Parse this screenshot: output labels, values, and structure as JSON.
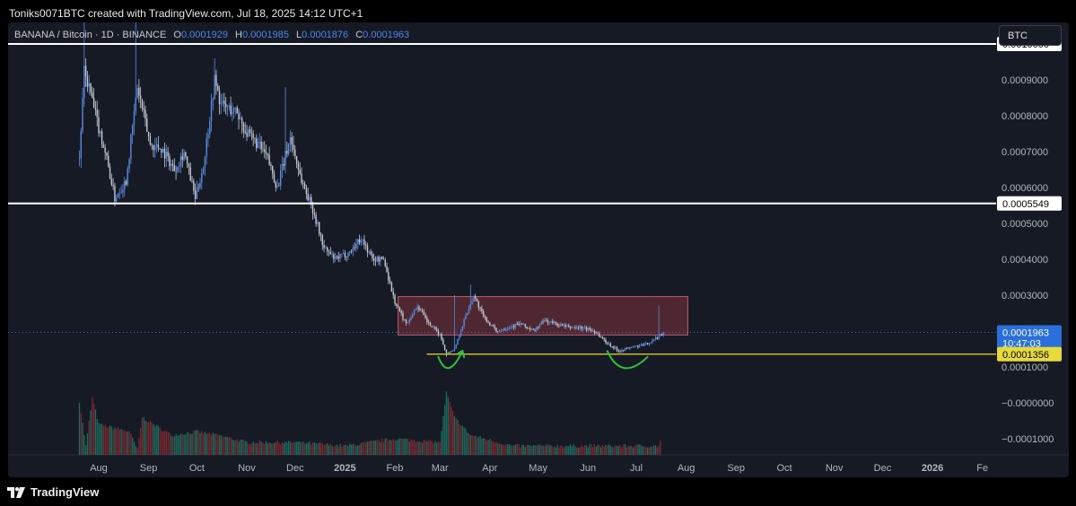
{
  "header": {
    "attribution": "Toniks0071BTC created with TradingView.com, Jul 18, 2025 14:12 UTC+1"
  },
  "footer": {
    "brand": "TradingView"
  },
  "legend": {
    "symbol": "BANANA / Bitcoin · 1D · BINANCE",
    "o_label": "O",
    "o_value": "0.0001929",
    "h_label": "H",
    "h_value": "0.0001985",
    "l_label": "L",
    "l_value": "0.0001876",
    "c_label": "C",
    "c_value": "0.0001963"
  },
  "currency_button": "BTC",
  "colors": {
    "background": "#161a25",
    "candle_up": "#5b8be0",
    "candle_down": "#c5c8d0",
    "volume_up": "#1f6b5e",
    "volume_down": "#7a2a31",
    "box_fill": "#5c2a35",
    "box_border": "#c0596b",
    "level_line": "#ffffff",
    "support_line": "#e6d93a",
    "pattern": "#35c03a",
    "price_badge": "#2a6fdb"
  },
  "chart_data": {
    "type": "candlestick",
    "scale": "linear",
    "y_tick_labels": [
      "0.0009000",
      "0.0008000",
      "0.0007000",
      "0.0006000",
      "0.0005000",
      "0.0004000",
      "0.0003000",
      "0.0001000",
      "−0.0000000",
      "−0.0001000"
    ],
    "y_tick_values": [
      0.0009,
      0.0008,
      0.0007,
      0.0006,
      0.0005,
      0.0004,
      0.0003,
      0.0001,
      0,
      -0.0001
    ],
    "ylim": [
      -0.000145,
      0.00106
    ],
    "x_tick_labels": [
      "Aug",
      "Sep",
      "Oct",
      "Nov",
      "Dec",
      "2025",
      "Feb",
      "Mar",
      "Apr",
      "May",
      "Jun",
      "Jul",
      "Aug",
      "Sep",
      "Oct",
      "Nov",
      "Dec",
      "2026",
      "Fe"
    ],
    "x_tick_dates": [
      "2024-08-01",
      "2024-09-01",
      "2024-10-01",
      "2024-11-01",
      "2024-12-01",
      "2025-01-01",
      "2025-02-01",
      "2025-03-01",
      "2025-04-01",
      "2025-05-01",
      "2025-06-01",
      "2025-07-01",
      "2025-08-01",
      "2025-09-01",
      "2025-10-01",
      "2025-11-01",
      "2025-12-01",
      "2026-01-01",
      "2026-02-01"
    ],
    "x_bold_labels": [
      "2025",
      "2026"
    ],
    "price_keypoints": [
      [
        "2024-07-20",
        0.00068
      ],
      [
        "2024-07-23",
        0.00092
      ],
      [
        "2024-07-26",
        0.00088
      ],
      [
        "2024-07-30",
        0.0008
      ],
      [
        "2024-08-05",
        0.0007
      ],
      [
        "2024-08-11",
        0.00057
      ],
      [
        "2024-08-18",
        0.00062
      ],
      [
        "2024-08-25",
        0.00088
      ],
      [
        "2024-09-02",
        0.00072
      ],
      [
        "2024-09-09",
        0.00071
      ],
      [
        "2024-09-17",
        0.00065
      ],
      [
        "2024-09-23",
        0.0007
      ],
      [
        "2024-09-30",
        0.00057
      ],
      [
        "2024-10-05",
        0.00066
      ],
      [
        "2024-10-12",
        0.0009
      ],
      [
        "2024-10-16",
        0.00083
      ],
      [
        "2024-10-26",
        0.00081
      ],
      [
        "2024-11-01",
        0.00075
      ],
      [
        "2024-11-08",
        0.00072
      ],
      [
        "2024-11-14",
        0.00068
      ],
      [
        "2024-11-20",
        0.0006
      ],
      [
        "2024-11-28",
        0.00074
      ],
      [
        "2024-12-05",
        0.00062
      ],
      [
        "2024-12-12",
        0.00054
      ],
      [
        "2024-12-19",
        0.00043
      ],
      [
        "2024-12-26",
        0.0004
      ],
      [
        "2025-01-04",
        0.00042
      ],
      [
        "2025-01-11",
        0.00046
      ],
      [
        "2025-01-18",
        0.0004
      ],
      [
        "2025-01-25",
        0.0004
      ],
      [
        "2025-02-01",
        0.00028
      ],
      [
        "2025-02-08",
        0.00022
      ],
      [
        "2025-02-15",
        0.00027
      ],
      [
        "2025-02-22",
        0.00022
      ],
      [
        "2025-03-01",
        0.00019
      ],
      [
        "2025-03-05",
        0.000138
      ],
      [
        "2025-03-10",
        0.00015
      ],
      [
        "2025-03-16",
        0.00023
      ],
      [
        "2025-03-22",
        0.0003
      ],
      [
        "2025-03-28",
        0.00024
      ],
      [
        "2025-04-05",
        0.0002
      ],
      [
        "2025-04-12",
        0.00021
      ],
      [
        "2025-04-20",
        0.00022
      ],
      [
        "2025-04-28",
        0.0002
      ],
      [
        "2025-05-05",
        0.00023
      ],
      [
        "2025-05-12",
        0.00022
      ],
      [
        "2025-05-20",
        0.00021
      ],
      [
        "2025-05-28",
        0.00021
      ],
      [
        "2025-06-05",
        0.0002
      ],
      [
        "2025-06-12",
        0.00017
      ],
      [
        "2025-06-20",
        0.000145
      ],
      [
        "2025-06-28",
        0.000155
      ],
      [
        "2025-07-05",
        0.00016
      ],
      [
        "2025-07-12",
        0.000175
      ],
      [
        "2025-07-18",
        0.0001963
      ]
    ],
    "volume_keypoints": [
      [
        "2024-07-20",
        5e-06
      ],
      [
        "2024-07-24",
        -0.00012
      ],
      [
        "2024-07-28",
        1.4e-05
      ],
      [
        "2024-08-01",
        -6e-05
      ],
      [
        "2024-08-20",
        -8e-05
      ],
      [
        "2024-08-25",
        -0.00013
      ],
      [
        "2024-08-28",
        -4e-05
      ],
      [
        "2024-09-15",
        -9e-05
      ],
      [
        "2024-10-01",
        -8e-05
      ],
      [
        "2024-10-14",
        -9e-05
      ],
      [
        "2024-11-01",
        -0.00011
      ],
      [
        "2024-12-01",
        -0.00011
      ],
      [
        "2025-01-01",
        -0.00012
      ],
      [
        "2025-02-01",
        -0.0001
      ],
      [
        "2025-03-01",
        -0.00011
      ],
      [
        "2025-03-05",
        2.8e-05
      ],
      [
        "2025-03-10",
        -4e-05
      ],
      [
        "2025-03-20",
        -9e-05
      ],
      [
        "2025-04-15",
        -0.00012
      ],
      [
        "2025-06-01",
        -0.00012
      ],
      [
        "2025-07-15",
        -0.00012
      ],
      [
        "2025-07-16",
        -0.000105
      ]
    ],
    "annotations": {
      "resistance_levels": [
        {
          "value": 0.001,
          "label": "0.0010000"
        },
        {
          "value": 0.00055549,
          "label": "0.0005549"
        }
      ],
      "support_level": {
        "value": 0.0001356,
        "label": "0.0001356",
        "start": "2025-02-03"
      },
      "range_box": {
        "start": "2025-02-03",
        "end": "2025-08-02",
        "top": 0.000296,
        "bottom": 0.000189
      },
      "double_bottom_marks": [
        {
          "points": [
            [
              "2025-02-28",
              0.000128
            ],
            [
              "2025-03-06",
              9.3e-05
            ],
            [
              "2025-03-15",
              0.000145
            ]
          ]
        },
        {
          "points": [
            [
              "2025-06-13",
              0.000144
            ],
            [
              "2025-06-22",
              9.3e-05
            ],
            [
              "2025-07-08",
              0.000128
            ]
          ]
        }
      ],
      "last_price": {
        "value": 0.0001963,
        "label": "0.0001963",
        "countdown": "10:47:03"
      }
    }
  }
}
